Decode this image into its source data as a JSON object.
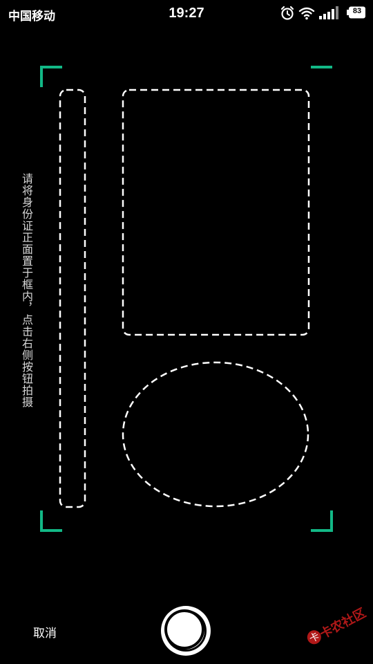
{
  "status_bar": {
    "carrier": "中国移动",
    "time": "19:27",
    "battery_level": "83",
    "icons": [
      "alarm-icon",
      "wifi-icon",
      "signal-icon",
      "battery-icon"
    ]
  },
  "camera": {
    "hint": "请将身份证正面置于框内，点击右侧按钮拍摄",
    "cancel_label": "取消",
    "shutter_icon": "shutter-icon",
    "accent_color": "#12b886"
  },
  "watermark": {
    "text": "卡农社区"
  }
}
